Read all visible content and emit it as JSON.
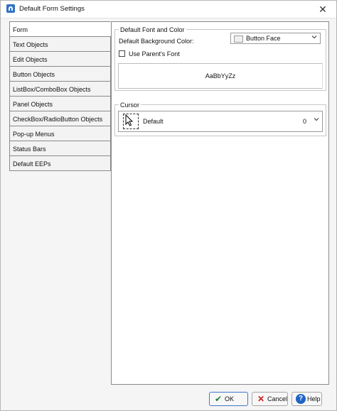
{
  "window": {
    "title": "Default Form Settings",
    "icon": "app-icon",
    "close_icon": "✕"
  },
  "sidebar": {
    "items": [
      {
        "label": "Form",
        "active": true
      },
      {
        "label": "Text Objects"
      },
      {
        "label": "Edit Objects"
      },
      {
        "label": "Button Objects"
      },
      {
        "label": "ListBox/ComboBox Objects"
      },
      {
        "label": "Panel Objects"
      },
      {
        "label": "CheckBox/RadioButton Objects"
      },
      {
        "label": "Pop-up Menus"
      },
      {
        "label": "Status Bars"
      },
      {
        "label": "Default EEPs"
      }
    ]
  },
  "font_color": {
    "group_title": "Default Font and Color",
    "bg_color_label": "Default Background Color:",
    "bg_color_value": "Button Face",
    "use_parent_font_label": "Use Parent's Font",
    "use_parent_font_checked": false,
    "preview_text": "AaBbYyZz"
  },
  "cursor": {
    "group_title": "Cursor",
    "selected_name": "Default",
    "selected_value": "0"
  },
  "buttons": {
    "ok": "OK",
    "cancel": "Cancel",
    "help": "Help"
  },
  "colors": {
    "accent": "#3f78c9",
    "ok_icon": "#1a7f37",
    "cancel_icon": "#d01a1a",
    "help_icon": "#1f63c7"
  }
}
